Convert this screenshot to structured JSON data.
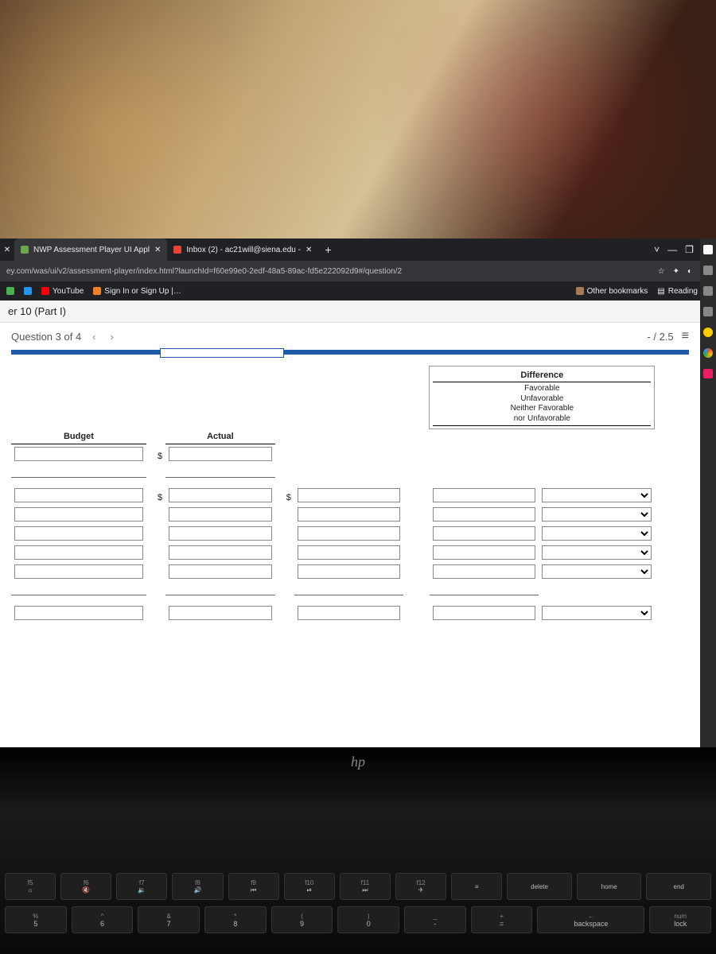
{
  "tabs": [
    {
      "title": "NWP Assessment Player UI Appl",
      "favicon": "#6aa84f"
    },
    {
      "title": "Inbox (2) - ac21will@siena.edu -",
      "favicon": "#ea4335"
    }
  ],
  "window_controls": {
    "min": "—",
    "restore": "❐",
    "close": "✕",
    "down": "˅"
  },
  "url": "ey.com/was/ui/v2/assessment-player/index.html?launchId=f60e99e0-2edf-48a5-89ac-fd5e222092d9#/question/2",
  "addr_icons": {
    "star": "☆",
    "ext": "✦",
    "profile": "◐",
    "menu": "⋮"
  },
  "bookmarks": {
    "items": [
      {
        "label": "YouTube",
        "color": "#ff0000"
      },
      {
        "label": "Sign In or Sign Up |…",
        "color": "#f48024"
      }
    ],
    "other": "Other bookmarks",
    "reading": "Reading list"
  },
  "page_title": "er 10 (Part I)",
  "question": {
    "label": "Question 3 of 4",
    "prev": "‹",
    "next": "›",
    "score": "- / 2.5",
    "list_icon": "≡"
  },
  "table": {
    "col_budget": "Budget",
    "col_actual": "Actual",
    "diff_header": "Difference",
    "diff_sub": [
      "Favorable",
      "Unfavorable",
      "Neither Favorable",
      "nor Unfavorable"
    ],
    "dollar": "$"
  },
  "keyboard": {
    "fn_row": [
      {
        "f": "f5",
        "sym": "☼"
      },
      {
        "f": "f6",
        "sym": "🔇"
      },
      {
        "f": "f7",
        "sym": "🔉"
      },
      {
        "f": "f8",
        "sym": "🔊"
      },
      {
        "f": "f9",
        "sym": "⏮"
      },
      {
        "f": "f10",
        "sym": "⏯"
      },
      {
        "f": "f11",
        "sym": "⏭"
      },
      {
        "f": "f12",
        "sym": "✈"
      },
      {
        "f": "",
        "sym": "≡"
      },
      {
        "f": "delete",
        "sym": ""
      },
      {
        "f": "home",
        "sym": ""
      },
      {
        "f": "end",
        "sym": ""
      }
    ],
    "num_row": [
      {
        "top": "%",
        "bot": "5"
      },
      {
        "top": "^",
        "bot": "6"
      },
      {
        "top": "&",
        "bot": "7"
      },
      {
        "top": "*",
        "bot": "8"
      },
      {
        "top": "(",
        "bot": "9"
      },
      {
        "top": ")",
        "bot": "0"
      },
      {
        "top": "_",
        "bot": "-"
      },
      {
        "top": "+",
        "bot": "="
      },
      {
        "top": "←",
        "bot": "backspace"
      },
      {
        "top": "num",
        "bot": "lock"
      }
    ]
  }
}
